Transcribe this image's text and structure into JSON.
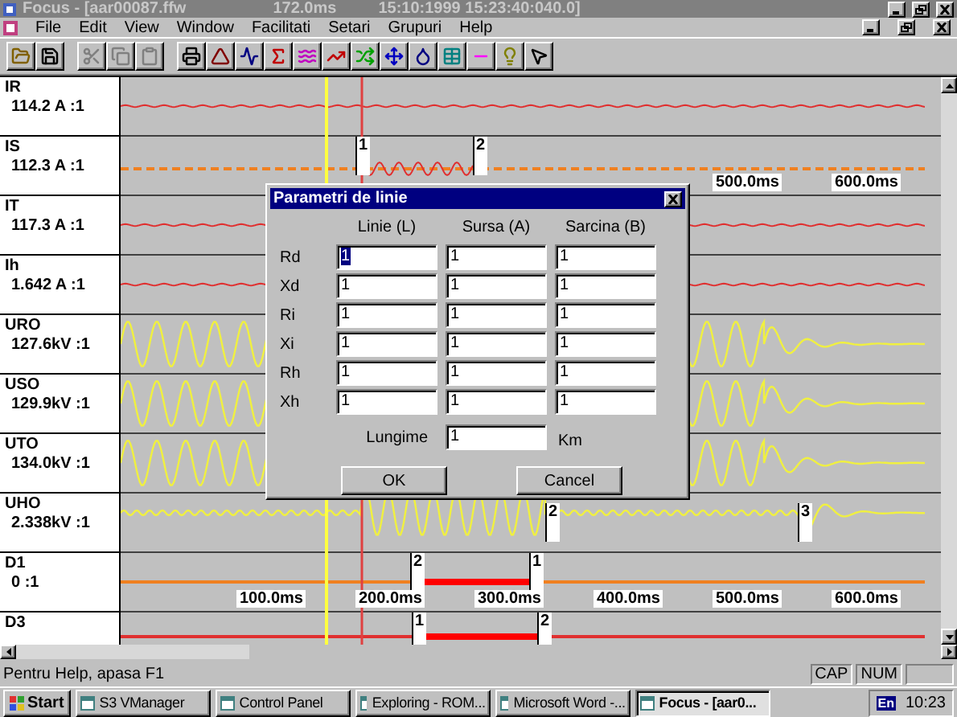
{
  "window": {
    "title": "Focus - [aar00087.ffw",
    "time_offset": "172.0ms",
    "timestamp": "15:10:1999 15:23:40:040.0]"
  },
  "menu": [
    "File",
    "Edit",
    "View",
    "Window",
    "Facilitati",
    "Setari",
    "Grupuri",
    "Help"
  ],
  "channels": [
    {
      "name": "IR",
      "reading": "114.2 A :1",
      "kind": "current"
    },
    {
      "name": "IS",
      "reading": "112.3 A :1",
      "kind": "current_fault",
      "markers": [
        "1",
        "2"
      ],
      "axis_labels": [
        "500.0ms",
        "600.0ms"
      ]
    },
    {
      "name": "IT",
      "reading": "117.3 A :1",
      "kind": "current"
    },
    {
      "name": "Ih",
      "reading": "1.642 A :1",
      "kind": "current"
    },
    {
      "name": "URO",
      "reading": "127.6kV :1",
      "kind": "voltage"
    },
    {
      "name": "USO",
      "reading": "129.9kV :1",
      "kind": "voltage"
    },
    {
      "name": "UTO",
      "reading": "134.0kV :1",
      "kind": "voltage"
    },
    {
      "name": "UHO",
      "reading": "2.338kV :1",
      "kind": "residual",
      "markers": [
        "2",
        "3"
      ]
    },
    {
      "name": "D1",
      "reading": "0 :1",
      "kind": "digital",
      "markers": [
        "2",
        "1"
      ],
      "axis_labels": [
        "100.0ms",
        "200.0ms",
        "300.0ms",
        "400.0ms",
        "500.0ms",
        "600.0ms"
      ]
    },
    {
      "name": "D3",
      "kind": "digital_low",
      "markers": [
        "1",
        "2"
      ]
    }
  ],
  "dialog": {
    "title": "Parametri de linie",
    "columns": [
      "Linie (L)",
      "Sursa (A)",
      "Sarcina (B)"
    ],
    "rows": [
      {
        "label": "Rd",
        "values": [
          {
            "text": "1",
            "highlighted": true
          },
          {
            "text": "1",
            "highlighted": false
          },
          {
            "text": "1",
            "highlighted": false
          }
        ]
      },
      {
        "label": "Xd",
        "values": [
          {
            "text": "1",
            "highlighted": false
          },
          {
            "text": "1",
            "highlighted": false
          },
          {
            "text": "1",
            "highlighted": false
          }
        ]
      },
      {
        "label": "Ri",
        "values": [
          {
            "text": "1",
            "highlighted": false
          },
          {
            "text": "1",
            "highlighted": false
          },
          {
            "text": "1",
            "highlighted": false
          }
        ]
      },
      {
        "label": "Xi",
        "values": [
          {
            "text": "1",
            "highlighted": false
          },
          {
            "text": "1",
            "highlighted": false
          },
          {
            "text": "1",
            "highlighted": false
          }
        ]
      },
      {
        "label": "Rh",
        "values": [
          {
            "text": "1",
            "highlighted": false
          },
          {
            "text": "1",
            "highlighted": false
          },
          {
            "text": "1",
            "highlighted": false
          }
        ]
      },
      {
        "label": "Xh",
        "values": [
          {
            "text": "1",
            "highlighted": false
          },
          {
            "text": "1",
            "highlighted": false
          },
          {
            "text": "1",
            "highlighted": false
          }
        ]
      }
    ],
    "length": {
      "label": "Lungime",
      "value": "1",
      "unit": "Km"
    },
    "buttons": [
      "OK",
      "Cancel"
    ]
  },
  "status_bar": {
    "message": "Pentru Help, apasa F1",
    "indicators": [
      "CAP",
      "NUM"
    ]
  },
  "taskbar": {
    "start": "Start",
    "tasks": [
      {
        "label": "S3 VManager",
        "selected": false
      },
      {
        "label": "Control Panel",
        "selected": false
      },
      {
        "label": "Exploring - ROM...",
        "selected": false
      },
      {
        "label": "Microsoft Word -...",
        "selected": false
      },
      {
        "label": "Focus - [aar0...",
        "selected": true
      }
    ],
    "tray_language": "En",
    "clock": "10:23"
  }
}
